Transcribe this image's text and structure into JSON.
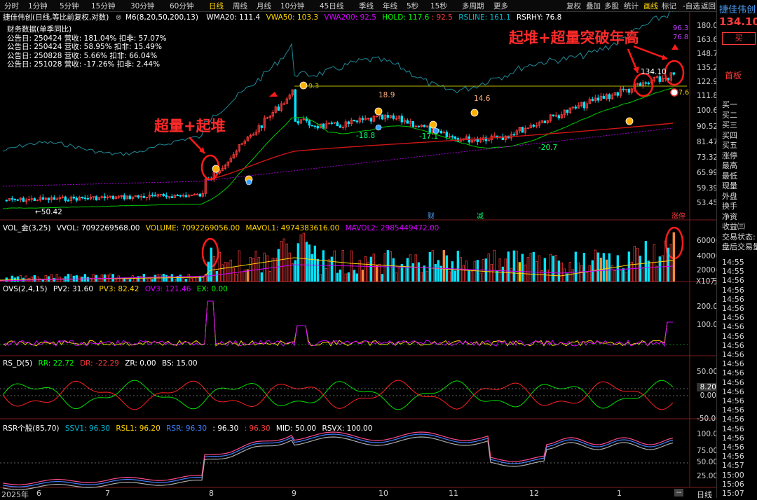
{
  "toolbar": {
    "periods": [
      "分时",
      "1分钟",
      "5分钟",
      "15分钟",
      "30分钟",
      "60分钟",
      "日线",
      "周线",
      "月线",
      "10分钟",
      "45日线",
      "季线",
      "年线",
      "5秒",
      "15秒",
      "多周期",
      "更多"
    ],
    "active_period": "日线",
    "right_items": [
      "复权",
      "叠加",
      "多股",
      "统计",
      "画线",
      "标记",
      "-自选",
      "返回"
    ]
  },
  "header": {
    "stock": "捷佳伟创(日线,等比前复权,对数)",
    "ma_label": "M6(8,20,50,200,13)",
    "wma20": "WMA20: 111.4",
    "vwa50": "VWA50: 103.3",
    "vwa200": "VWA200: 92.5",
    "hold": "HOLD: 117.6",
    "hold2": ": 92.5",
    "rsline": "RSLINE: 161.1",
    "rsrhy": "RSRHY: 76.8"
  },
  "finance": {
    "title": "财务数据(单季同比)",
    "rows": [
      "公告日: 250424  营收: 181.04%  扣非: 57.07%",
      "公告日: 250424  营收: 58.95%  扣非: 15.49%",
      "公告日: 250828  营收: 5.66%  扣非: 66.04%",
      "公告日: 251028  营收: -17.26%  扣非: 2.44%"
    ]
  },
  "annotations": {
    "left": "超量+起堆",
    "right": "起堆+超量突破年高",
    "price_tag": "134.10",
    "low_tag": "←50.42",
    "hl_189": "18.9",
    "hl_146": "14.6",
    "hl_188": "-18.8",
    "hl_171": "-17.1",
    "hl_207": "-20.7",
    "tag_93": "9.3",
    "tag_76": "7.6",
    "rs_top": "96.3",
    "rs_top2": "76.8",
    "marker_cai": "财",
    "marker_jian": "减",
    "marker_zhangting": "涨停"
  },
  "axes": {
    "price": [
      "180.0",
      "163.6",
      "148.7",
      "135.2",
      "122.9",
      "111.8",
      "100.6",
      "90.52",
      "81.47",
      "73.32",
      "65.99",
      "59.39",
      "53.45"
    ],
    "volume": [
      "60000",
      "40000",
      "20000"
    ],
    "volume_unit": "X10万",
    "ovs": [
      "200.0",
      "100.0"
    ],
    "rsd": [
      "50.00",
      "0.00",
      "-50.00"
    ],
    "rsd_current": "8.20",
    "rsr": [
      "100.0",
      "75.00",
      "50.00",
      "25.00"
    ],
    "months": [
      "2025年",
      "6",
      "7",
      "8",
      "9",
      "10",
      "11",
      "12",
      "1"
    ]
  },
  "indicators": {
    "vol": {
      "name": "VOL_金(3,25)",
      "vvol": "VVOL: 7092269568.00",
      "volume": "VOLUME: 7092269056.00",
      "mavol1": "MAVOL1: 4974383616.00",
      "mavol2": "MAVOL2: 2985449472.00"
    },
    "ovs": {
      "name": "OVS(2,4,15)",
      "pv2": "PV2: 31.60",
      "pv3": "PV3: 82.42",
      "ov3": "OV3: 121.46",
      "ex": "EX: 0.00"
    },
    "rsd": {
      "name": "RS_D(5)",
      "rr": "RR: 22.72",
      "dr": "DR: -22.29",
      "zr": "ZR: 0.00",
      "bs": "BS: 15.00"
    },
    "rsr": {
      "name": "RSR个股(85,70)",
      "ssv1": "SSV1: 96.30",
      "rsl1": "RSL1: 96.20",
      "rsr": "RSR: 96.30",
      "v4": ": 96.30",
      "v5": ": 96.30",
      "mid": "MID: 50.00",
      "rsvx": "RSVX: 100.00"
    }
  },
  "sidebar": {
    "name": "捷佳伟创",
    "price": "134.10",
    "buy_btn": "买",
    "board": "首板",
    "labels": [
      "买一",
      "买二",
      "买三",
      "买四",
      "买五",
      "涨停",
      "最高",
      "最低",
      "现量",
      "外盘",
      "换手",
      "净资",
      "收益㈢",
      "交易状态: 正",
      "盘后交易量"
    ],
    "times": [
      "14:55",
      "14:55",
      "14:56",
      "14:56",
      "14:56",
      "14:56",
      "14:56",
      "14:56",
      "14:56",
      "14:56",
      "14:56",
      "14:56",
      "14:56",
      "14:56",
      "14:56",
      "14:56",
      "14:56",
      "14:56",
      "14:56",
      "14:56",
      "14:56",
      "14:56",
      "14:57",
      "15:00",
      "15:06",
      "15:07"
    ],
    "bottom_tab": "日线"
  },
  "colors": {
    "up": "#ff3b3b",
    "down": "#00e5ff",
    "yellow": "#ffd400",
    "purple": "#d400ff",
    "green": "#00ff00",
    "white": "#ffffff",
    "orange": "#ff8a3c"
  }
}
